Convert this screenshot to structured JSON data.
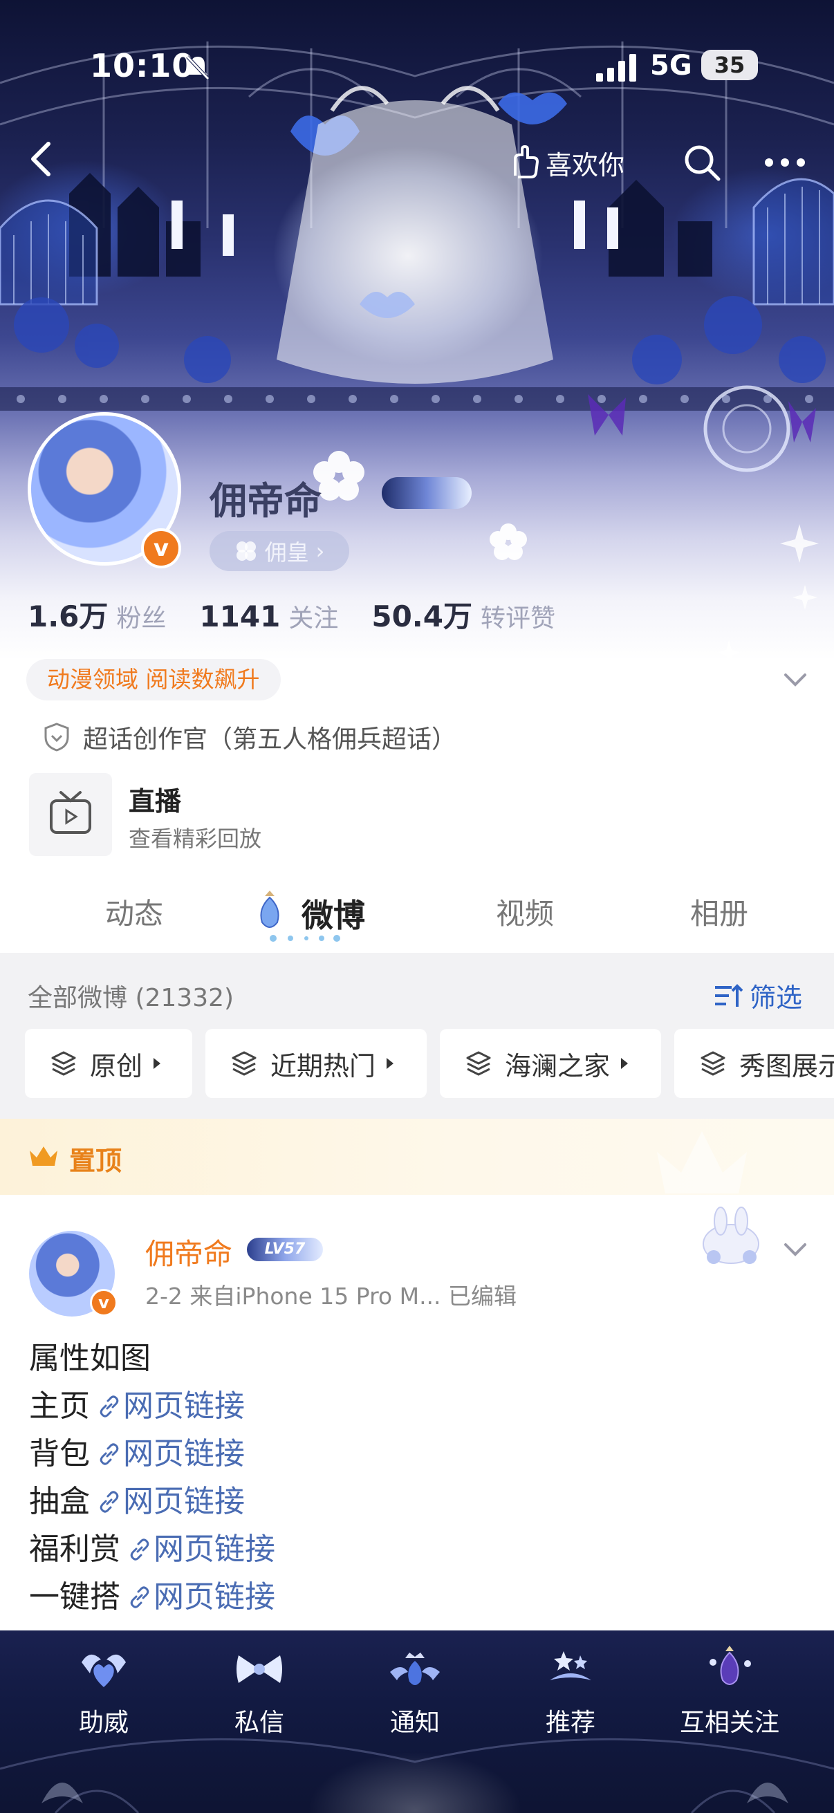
{
  "status_bar": {
    "time": "10:10",
    "network": "5G",
    "battery": "35"
  },
  "nav": {
    "like_you": "喜欢你"
  },
  "profile": {
    "username": "佣帝命",
    "avatar_badge": "v",
    "rank_label": "佣皇",
    "stats": [
      {
        "value": "1.6万",
        "label": "粉丝"
      },
      {
        "value": "1141",
        "label": "关注"
      },
      {
        "value": "50.4万",
        "label": "转评赞"
      }
    ],
    "domain_tag": "动漫领域 阅读数飙升",
    "super_topic": "超话创作官（第五人格佣兵超话）",
    "live": {
      "title": "直播",
      "subtitle": "查看精彩回放"
    }
  },
  "tabs": [
    {
      "label": "动态",
      "active": false
    },
    {
      "label": "微博",
      "active": true
    },
    {
      "label": "视频",
      "active": false
    },
    {
      "label": "相册",
      "active": false
    }
  ],
  "feed": {
    "title": "全部微博 (21332)",
    "filter_label": "筛选",
    "chips": [
      "原创",
      "近期热门",
      "海澜之家",
      "秀图展示"
    ]
  },
  "pinned": {
    "label": "置顶",
    "post": {
      "author": "佣帝命",
      "level_badge": "LV57",
      "meta": "2-2  来自iPhone 15 Pro M...  已编辑",
      "lines": [
        {
          "text": "属性如图",
          "link": ""
        },
        {
          "text": "主页",
          "link": "网页链接"
        },
        {
          "text": "背包",
          "link": "网页链接"
        },
        {
          "text": "抽盒",
          "link": "网页链接"
        },
        {
          "text": "福利赏",
          "link": "网页链接"
        },
        {
          "text": "一键搭",
          "link": "网页链接"
        }
      ]
    }
  },
  "bottom_bar": [
    {
      "label": "助威",
      "icon": "wing-heart-icon"
    },
    {
      "label": "私信",
      "icon": "bow-icon"
    },
    {
      "label": "通知",
      "icon": "crown-gem-icon"
    },
    {
      "label": "推荐",
      "icon": "star-wing-icon"
    },
    {
      "label": "互相关注",
      "icon": "gem-pendant-icon"
    }
  ]
}
